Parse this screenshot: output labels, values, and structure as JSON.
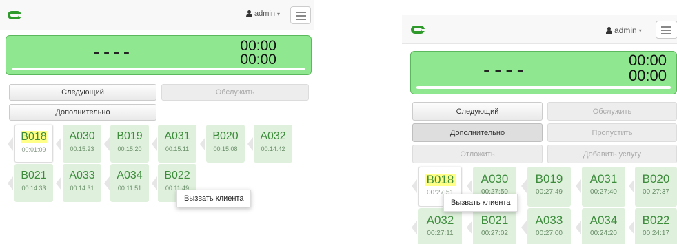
{
  "user": {
    "name": "admin",
    "caret": "▾"
  },
  "left": {
    "display": {
      "dashes": "----",
      "time1": "00:00",
      "time2": "00:00"
    },
    "buttons": {
      "next": "Следующий",
      "serve": "Обслужить",
      "more": "Дополнительно"
    },
    "tickets": [
      {
        "code": "B018",
        "time": "00:01:09"
      },
      {
        "code": "A030",
        "time": "00:15:23"
      },
      {
        "code": "B019",
        "time": "00:15:20"
      },
      {
        "code": "A031",
        "time": "00:15:11"
      },
      {
        "code": "B020",
        "time": "00:15:08"
      },
      {
        "code": "A032",
        "time": "00:14:42"
      },
      {
        "code": "B021",
        "time": "00:14:33"
      },
      {
        "code": "A033",
        "time": "00:14:31"
      },
      {
        "code": "A034",
        "time": "00:11:51"
      },
      {
        "code": "B022",
        "time": "00:11:49"
      }
    ],
    "tooltip": "Вызвать клиента"
  },
  "right": {
    "display": {
      "dashes": "----",
      "time1": "00:00",
      "time2": "00:00"
    },
    "buttons": {
      "next": "Следующий",
      "serve": "Обслужить",
      "more": "Дополнительно",
      "skip": "Пропустить",
      "postpone": "Отложить",
      "add_service": "Добавить услугу"
    },
    "tickets": [
      {
        "code": "B018",
        "time": "00:27:51"
      },
      {
        "code": "A030",
        "time": "00:27:50"
      },
      {
        "code": "B019",
        "time": "00:27:49"
      },
      {
        "code": "A031",
        "time": "00:27:40"
      },
      {
        "code": "B020",
        "time": "00:27:37"
      },
      {
        "code": "A032",
        "time": "00:27:11"
      },
      {
        "code": "B021",
        "time": "00:27:02"
      },
      {
        "code": "A033",
        "time": "00:27:00"
      },
      {
        "code": "A034",
        "time": "00:24:20"
      },
      {
        "code": "B022",
        "time": "00:24:17"
      }
    ],
    "tooltip": "Вызвать клиента"
  },
  "colors": {
    "accent": "#2f9a2c",
    "display_bg": "#8fe88f",
    "tile_bg": "#dff1dc",
    "highlight": "#ffff88"
  }
}
